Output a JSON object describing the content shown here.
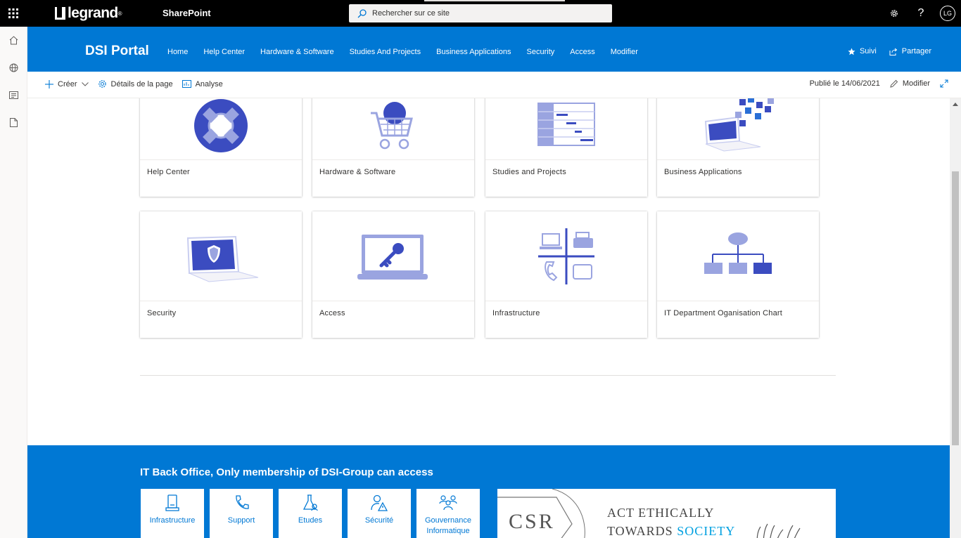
{
  "suite": {
    "brand": "legrand",
    "app": "SharePoint",
    "search_placeholder": "Rechercher sur ce site",
    "avatar": "LG"
  },
  "site": {
    "title": "DSI Portal",
    "nav": [
      "Home",
      "Help Center",
      "Hardware & Software",
      "Studies And Projects",
      "Business Applications",
      "Security",
      "Access",
      "Modifier"
    ],
    "follow": "Suivi",
    "share": "Partager"
  },
  "command": {
    "create": "Créer",
    "details": "Détails de la page",
    "analytics": "Analyse",
    "published": "Publié le 14/06/2021",
    "edit": "Modifier"
  },
  "tiles": [
    {
      "label": "Help Center",
      "icon": "lifebuoy-icon"
    },
    {
      "label": "Hardware & Software",
      "icon": "shopping-cart-icon"
    },
    {
      "label": "Studies and Projects",
      "icon": "gantt-chart-icon"
    },
    {
      "label": "Business Applications",
      "icon": "laptop-apps-icon"
    },
    {
      "label": "Security",
      "icon": "laptop-shield-icon"
    },
    {
      "label": "Access",
      "icon": "laptop-key-icon"
    },
    {
      "label": "Infrastructure",
      "icon": "infrastructure-icon"
    },
    {
      "label": "IT Department Oganisation Chart",
      "icon": "org-chart-icon"
    }
  ],
  "backoffice": {
    "title": "IT Back Office, Only membership of DSI-Group can access",
    "items": [
      {
        "label": "Infrastructure",
        "icon": "phone-icon"
      },
      {
        "label": "Support",
        "icon": "handset-icon"
      },
      {
        "label": "Etudes",
        "icon": "flask-icon"
      },
      {
        "label": "Sécurité",
        "icon": "user-warning-icon"
      },
      {
        "label": "Gouvernance Informatique",
        "icon": "people-group-icon"
      }
    ],
    "banner": {
      "csr": "CSR",
      "line1": "ACT ETHICALLY",
      "line2": "TOWARDS",
      "line2_accent": "SOCIETY"
    }
  },
  "colors": {
    "brand": "#0078d4",
    "icon_dark": "#3b4cc0",
    "icon_light": "#9aa4e0"
  }
}
